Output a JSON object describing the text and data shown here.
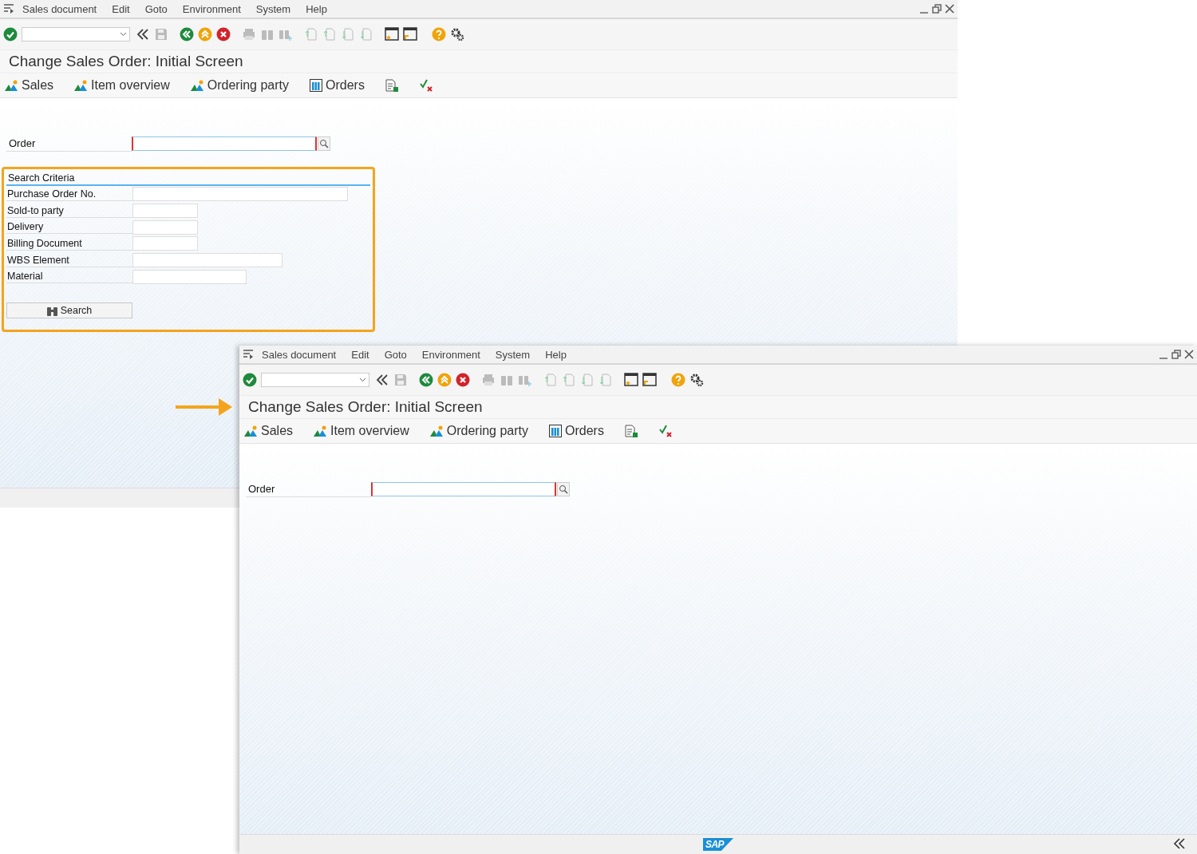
{
  "windows": [
    {
      "menu": [
        "Sales document",
        "Edit",
        "Goto",
        "Environment",
        "System",
        "Help"
      ],
      "title": "Change Sales Order: Initial Screen",
      "nav": [
        {
          "kind": "mountain",
          "label": "Sales"
        },
        {
          "kind": "mountain",
          "label": "Item overview"
        },
        {
          "kind": "mountain",
          "label": "Ordering party"
        },
        {
          "kind": "columns",
          "label": "Orders"
        },
        {
          "kind": "document"
        },
        {
          "kind": "check"
        }
      ],
      "order_label": "Order",
      "search_criteria": {
        "title": "Search Criteria",
        "fields": [
          "Purchase Order No.",
          "Sold-to party",
          "Delivery",
          "Billing Document",
          "WBS Element",
          "Material"
        ],
        "button": "Search"
      }
    },
    {
      "menu": [
        "Sales document",
        "Edit",
        "Goto",
        "Environment",
        "System",
        "Help"
      ],
      "title": "Change Sales Order: Initial Screen",
      "nav": [
        {
          "kind": "mountain",
          "label": "Sales"
        },
        {
          "kind": "mountain",
          "label": "Item overview"
        },
        {
          "kind": "mountain",
          "label": "Ordering party"
        },
        {
          "kind": "columns",
          "label": "Orders"
        },
        {
          "kind": "document"
        },
        {
          "kind": "check"
        }
      ],
      "order_label": "Order",
      "status_logo": "SAP"
    }
  ]
}
